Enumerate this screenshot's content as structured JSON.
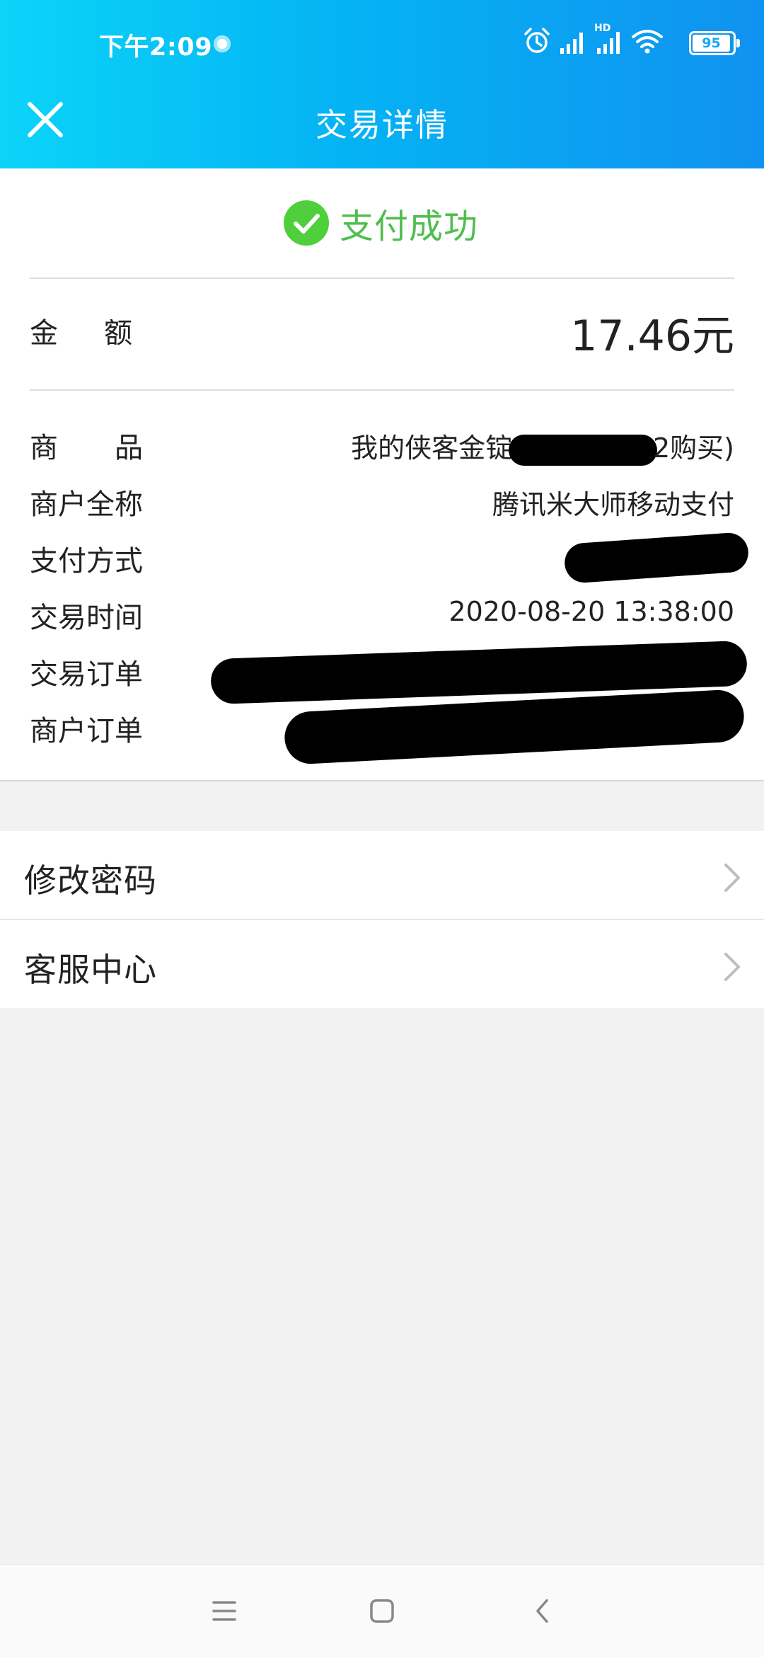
{
  "status_bar": {
    "time": "下午2:09",
    "battery": "95",
    "hd_label": "HD",
    "icons": [
      "alarm-icon",
      "signal-icon",
      "signal-hd-icon",
      "wifi-icon",
      "battery-icon"
    ]
  },
  "header": {
    "title": "交易详情",
    "close_icon": "close-icon"
  },
  "status": {
    "text": "支付成功",
    "color": "#4fbe4f"
  },
  "amount": {
    "label": "金额",
    "value": "17.46元"
  },
  "details": [
    {
      "label": "商品",
      "value": "我的侠客金锭(",
      "value_tail": "2购买)"
    },
    {
      "label": "商户全称",
      "value": "腾讯米大师移动支付"
    },
    {
      "label": "支付方式",
      "value": ""
    },
    {
      "label": "交易时间",
      "value": "2020-08-20 13:38:00"
    },
    {
      "label": "交易订单",
      "value": ""
    },
    {
      "label": "商户订单",
      "value": ""
    }
  ],
  "menu": [
    {
      "label": "修改密码",
      "icon": "chevron-right-icon"
    },
    {
      "label": "客服中心",
      "icon": "chevron-right-icon"
    }
  ],
  "colors": {
    "header_gradient_start": "#0bd4f8",
    "header_gradient_end": "#1092f0",
    "success_green": "#4fbe4f",
    "page_background": "#f2f2f2"
  },
  "nav_bar": [
    "menu-icon",
    "home-icon",
    "back-icon"
  ]
}
